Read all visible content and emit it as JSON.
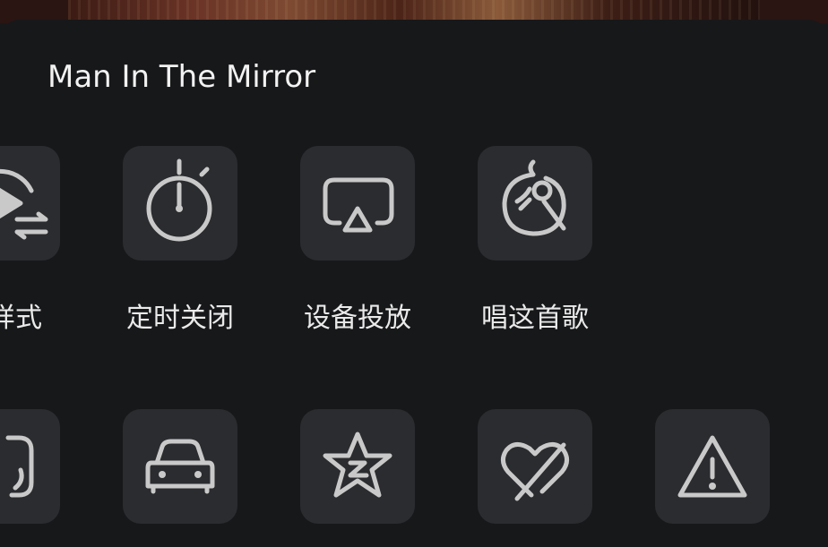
{
  "song": {
    "title": "Man In The Mirror"
  },
  "row1": [
    {
      "label": "器样式",
      "icon": "player-style-icon"
    },
    {
      "label": "定时关闭",
      "icon": "timer-icon"
    },
    {
      "label": "设备投放",
      "icon": "airplay-icon"
    },
    {
      "label": "唱这首歌",
      "icon": "karaoke-icon"
    }
  ],
  "row2": [
    {
      "icon": "note-icon"
    },
    {
      "icon": "car-icon"
    },
    {
      "icon": "star-icon"
    },
    {
      "icon": "heart-slash-icon"
    },
    {
      "icon": "warning-icon"
    }
  ],
  "colors": {
    "background": "#17181a",
    "tile": "#2b2c2f",
    "icon_stroke": "#c9c9c9",
    "text": "#eaeaea"
  }
}
